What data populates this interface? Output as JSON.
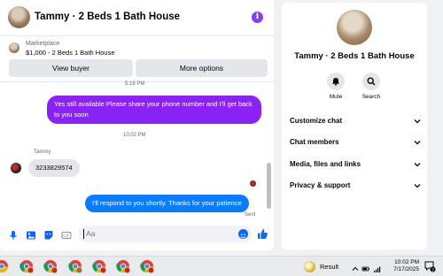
{
  "chat": {
    "title": "Tammy · 2 Beds 1 Bath House",
    "listing": {
      "source": "Marketplace",
      "title": "$1,000 - 2 Beds 1 Bath House",
      "view_buyer": "View buyer",
      "more_options": "More options"
    },
    "messages": {
      "ts_top": "5:19 PM",
      "bubble1": "Yes still available Please share your phone number and I'll get back to you soon",
      "ts_mid": "10:02 PM",
      "sender": "Tammy",
      "incoming": "3233829574",
      "bubble2": "I'll respond to you shortly. Thanks for your patience",
      "status": "Sent"
    },
    "composer": {
      "placeholder": "Aa"
    }
  },
  "side": {
    "title": "Tammy · 2 Beds 1 Bath House",
    "mute": "Mute",
    "search": "Search",
    "rows": [
      "Customize chat",
      "Chat members",
      "Media, files and links",
      "Privacy & support"
    ]
  },
  "taskbar": {
    "result": "Result",
    "time": "10:02 PM",
    "date": "7/17/2025",
    "badge": "2"
  },
  "colors": {
    "purple": "#8a21f5",
    "blue": "#0a7cff",
    "accent": "#0866ff"
  }
}
